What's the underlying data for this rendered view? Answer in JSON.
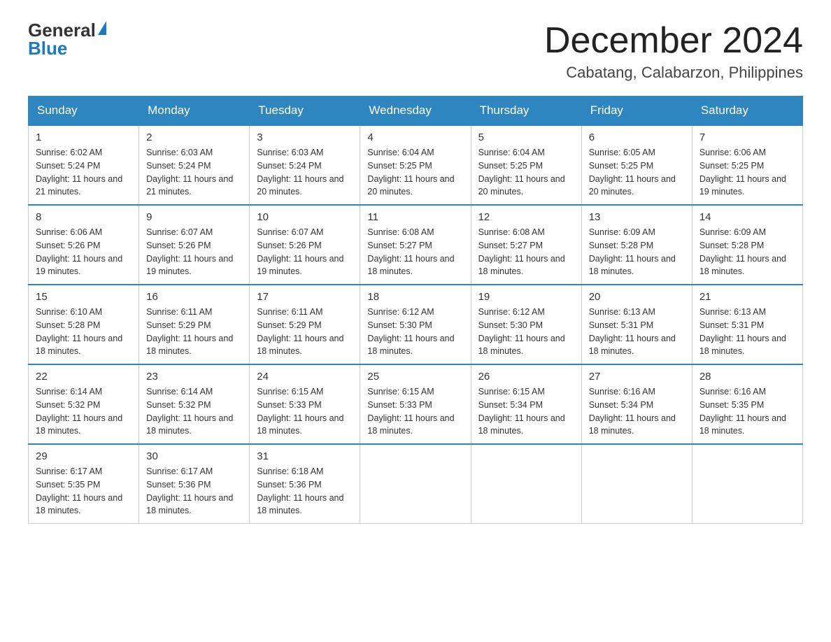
{
  "header": {
    "logo_general": "General",
    "logo_blue": "Blue",
    "title": "December 2024",
    "location": "Cabatang, Calabarzon, Philippines"
  },
  "weekdays": [
    "Sunday",
    "Monday",
    "Tuesday",
    "Wednesday",
    "Thursday",
    "Friday",
    "Saturday"
  ],
  "weeks": [
    [
      {
        "day": "1",
        "sunrise": "Sunrise: 6:02 AM",
        "sunset": "Sunset: 5:24 PM",
        "daylight": "Daylight: 11 hours and 21 minutes."
      },
      {
        "day": "2",
        "sunrise": "Sunrise: 6:03 AM",
        "sunset": "Sunset: 5:24 PM",
        "daylight": "Daylight: 11 hours and 21 minutes."
      },
      {
        "day": "3",
        "sunrise": "Sunrise: 6:03 AM",
        "sunset": "Sunset: 5:24 PM",
        "daylight": "Daylight: 11 hours and 20 minutes."
      },
      {
        "day": "4",
        "sunrise": "Sunrise: 6:04 AM",
        "sunset": "Sunset: 5:25 PM",
        "daylight": "Daylight: 11 hours and 20 minutes."
      },
      {
        "day": "5",
        "sunrise": "Sunrise: 6:04 AM",
        "sunset": "Sunset: 5:25 PM",
        "daylight": "Daylight: 11 hours and 20 minutes."
      },
      {
        "day": "6",
        "sunrise": "Sunrise: 6:05 AM",
        "sunset": "Sunset: 5:25 PM",
        "daylight": "Daylight: 11 hours and 20 minutes."
      },
      {
        "day": "7",
        "sunrise": "Sunrise: 6:06 AM",
        "sunset": "Sunset: 5:25 PM",
        "daylight": "Daylight: 11 hours and 19 minutes."
      }
    ],
    [
      {
        "day": "8",
        "sunrise": "Sunrise: 6:06 AM",
        "sunset": "Sunset: 5:26 PM",
        "daylight": "Daylight: 11 hours and 19 minutes."
      },
      {
        "day": "9",
        "sunrise": "Sunrise: 6:07 AM",
        "sunset": "Sunset: 5:26 PM",
        "daylight": "Daylight: 11 hours and 19 minutes."
      },
      {
        "day": "10",
        "sunrise": "Sunrise: 6:07 AM",
        "sunset": "Sunset: 5:26 PM",
        "daylight": "Daylight: 11 hours and 19 minutes."
      },
      {
        "day": "11",
        "sunrise": "Sunrise: 6:08 AM",
        "sunset": "Sunset: 5:27 PM",
        "daylight": "Daylight: 11 hours and 18 minutes."
      },
      {
        "day": "12",
        "sunrise": "Sunrise: 6:08 AM",
        "sunset": "Sunset: 5:27 PM",
        "daylight": "Daylight: 11 hours and 18 minutes."
      },
      {
        "day": "13",
        "sunrise": "Sunrise: 6:09 AM",
        "sunset": "Sunset: 5:28 PM",
        "daylight": "Daylight: 11 hours and 18 minutes."
      },
      {
        "day": "14",
        "sunrise": "Sunrise: 6:09 AM",
        "sunset": "Sunset: 5:28 PM",
        "daylight": "Daylight: 11 hours and 18 minutes."
      }
    ],
    [
      {
        "day": "15",
        "sunrise": "Sunrise: 6:10 AM",
        "sunset": "Sunset: 5:28 PM",
        "daylight": "Daylight: 11 hours and 18 minutes."
      },
      {
        "day": "16",
        "sunrise": "Sunrise: 6:11 AM",
        "sunset": "Sunset: 5:29 PM",
        "daylight": "Daylight: 11 hours and 18 minutes."
      },
      {
        "day": "17",
        "sunrise": "Sunrise: 6:11 AM",
        "sunset": "Sunset: 5:29 PM",
        "daylight": "Daylight: 11 hours and 18 minutes."
      },
      {
        "day": "18",
        "sunrise": "Sunrise: 6:12 AM",
        "sunset": "Sunset: 5:30 PM",
        "daylight": "Daylight: 11 hours and 18 minutes."
      },
      {
        "day": "19",
        "sunrise": "Sunrise: 6:12 AM",
        "sunset": "Sunset: 5:30 PM",
        "daylight": "Daylight: 11 hours and 18 minutes."
      },
      {
        "day": "20",
        "sunrise": "Sunrise: 6:13 AM",
        "sunset": "Sunset: 5:31 PM",
        "daylight": "Daylight: 11 hours and 18 minutes."
      },
      {
        "day": "21",
        "sunrise": "Sunrise: 6:13 AM",
        "sunset": "Sunset: 5:31 PM",
        "daylight": "Daylight: 11 hours and 18 minutes."
      }
    ],
    [
      {
        "day": "22",
        "sunrise": "Sunrise: 6:14 AM",
        "sunset": "Sunset: 5:32 PM",
        "daylight": "Daylight: 11 hours and 18 minutes."
      },
      {
        "day": "23",
        "sunrise": "Sunrise: 6:14 AM",
        "sunset": "Sunset: 5:32 PM",
        "daylight": "Daylight: 11 hours and 18 minutes."
      },
      {
        "day": "24",
        "sunrise": "Sunrise: 6:15 AM",
        "sunset": "Sunset: 5:33 PM",
        "daylight": "Daylight: 11 hours and 18 minutes."
      },
      {
        "day": "25",
        "sunrise": "Sunrise: 6:15 AM",
        "sunset": "Sunset: 5:33 PM",
        "daylight": "Daylight: 11 hours and 18 minutes."
      },
      {
        "day": "26",
        "sunrise": "Sunrise: 6:15 AM",
        "sunset": "Sunset: 5:34 PM",
        "daylight": "Daylight: 11 hours and 18 minutes."
      },
      {
        "day": "27",
        "sunrise": "Sunrise: 6:16 AM",
        "sunset": "Sunset: 5:34 PM",
        "daylight": "Daylight: 11 hours and 18 minutes."
      },
      {
        "day": "28",
        "sunrise": "Sunrise: 6:16 AM",
        "sunset": "Sunset: 5:35 PM",
        "daylight": "Daylight: 11 hours and 18 minutes."
      }
    ],
    [
      {
        "day": "29",
        "sunrise": "Sunrise: 6:17 AM",
        "sunset": "Sunset: 5:35 PM",
        "daylight": "Daylight: 11 hours and 18 minutes."
      },
      {
        "day": "30",
        "sunrise": "Sunrise: 6:17 AM",
        "sunset": "Sunset: 5:36 PM",
        "daylight": "Daylight: 11 hours and 18 minutes."
      },
      {
        "day": "31",
        "sunrise": "Sunrise: 6:18 AM",
        "sunset": "Sunset: 5:36 PM",
        "daylight": "Daylight: 11 hours and 18 minutes."
      },
      null,
      null,
      null,
      null
    ]
  ]
}
